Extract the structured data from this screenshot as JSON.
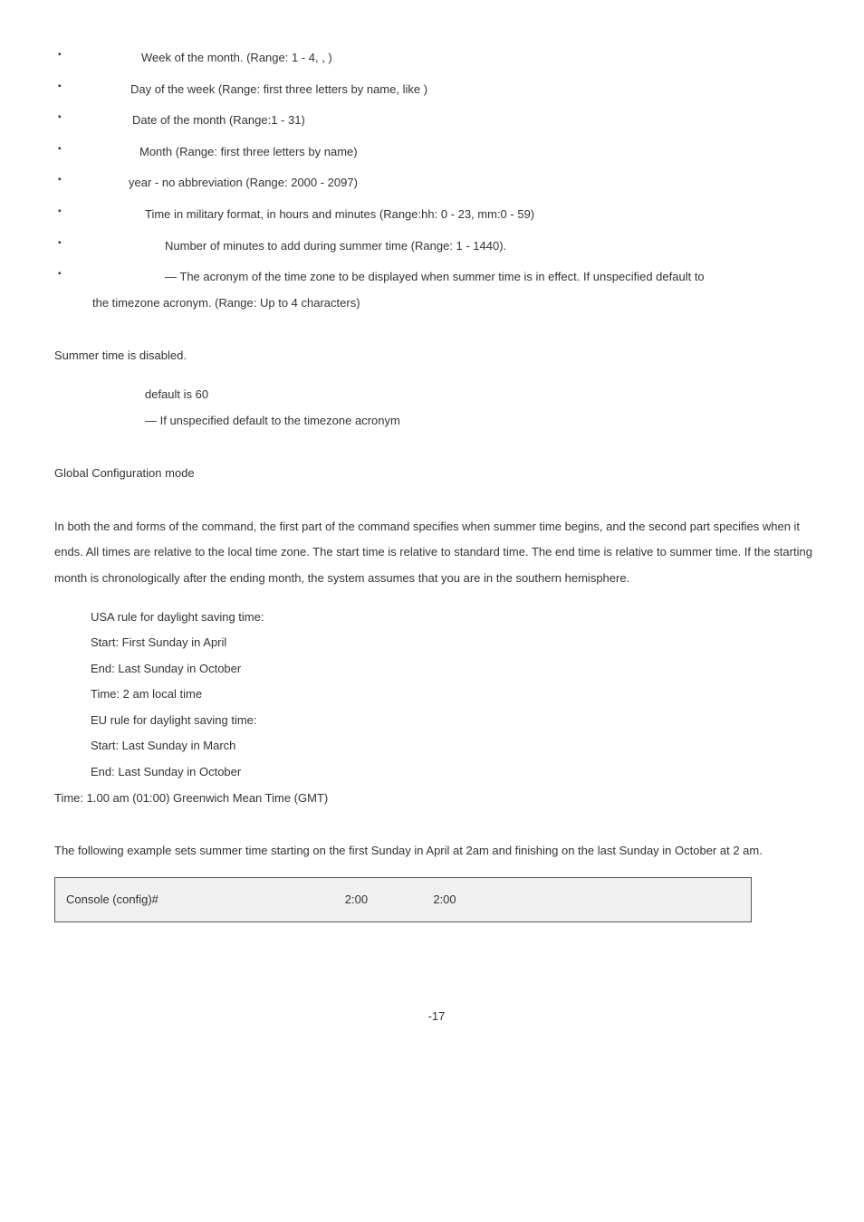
{
  "bullets": [
    "Week of the month. (Range: 1 - 4,      ,      )",
    "Day of the week (Range: first three letters by name, like      )",
    "Date of the month (Range:1 - 31)",
    "Month (Range: first three letters by name)",
    "year - no abbreviation (Range: 2000 - 2097)",
    "Time in military format, in hours and minutes (Range:hh: 0 - 23, mm:0 - 59)",
    "Number of minutes to add during summer time (Range: 1 - 1440).",
    "— The acronym of the time zone to be displayed when summer time is in effect. If unspecified default to"
  ],
  "bullet_paddings": [
    "74px",
    "62px",
    "64px",
    "72px",
    "60px",
    "78px",
    "100px",
    "100px"
  ],
  "bullet_tail": "the timezone acronym. (Range: Up to 4 characters)",
  "disabled": "Summer time is disabled.",
  "defaults": {
    "line1": "default is 60",
    "line2": "— If unspecified default to the timezone acronym"
  },
  "mode": "Global Configuration mode",
  "desc": "In both the          and               forms of the command, the first part of the command specifies when summer time begins, and the second part specifies when it ends. All times are relative to the local time zone. The start time is relative to standard time. The end time is relative to summer time. If the starting month is chronologically after the ending month, the system assumes that you are in the southern hemisphere.",
  "rules": [
    "USA rule for daylight saving time:",
    "Start: First Sunday in April",
    "End: Last Sunday in October",
    "Time: 2 am local time",
    "EU rule for daylight saving time:",
    "Start: Last Sunday in March",
    "End: Last Sunday in October"
  ],
  "gmt_line": "Time: 1.00 am (01:00) Greenwich Mean Time (GMT)",
  "example": "The following example sets summer time starting on the first Sunday in April at 2am and finishing on the last Sunday in October at 2 am.",
  "console": {
    "prompt": "Console (config)#",
    "t1": "2:00",
    "t2": "2:00"
  },
  "page_number": "-17"
}
